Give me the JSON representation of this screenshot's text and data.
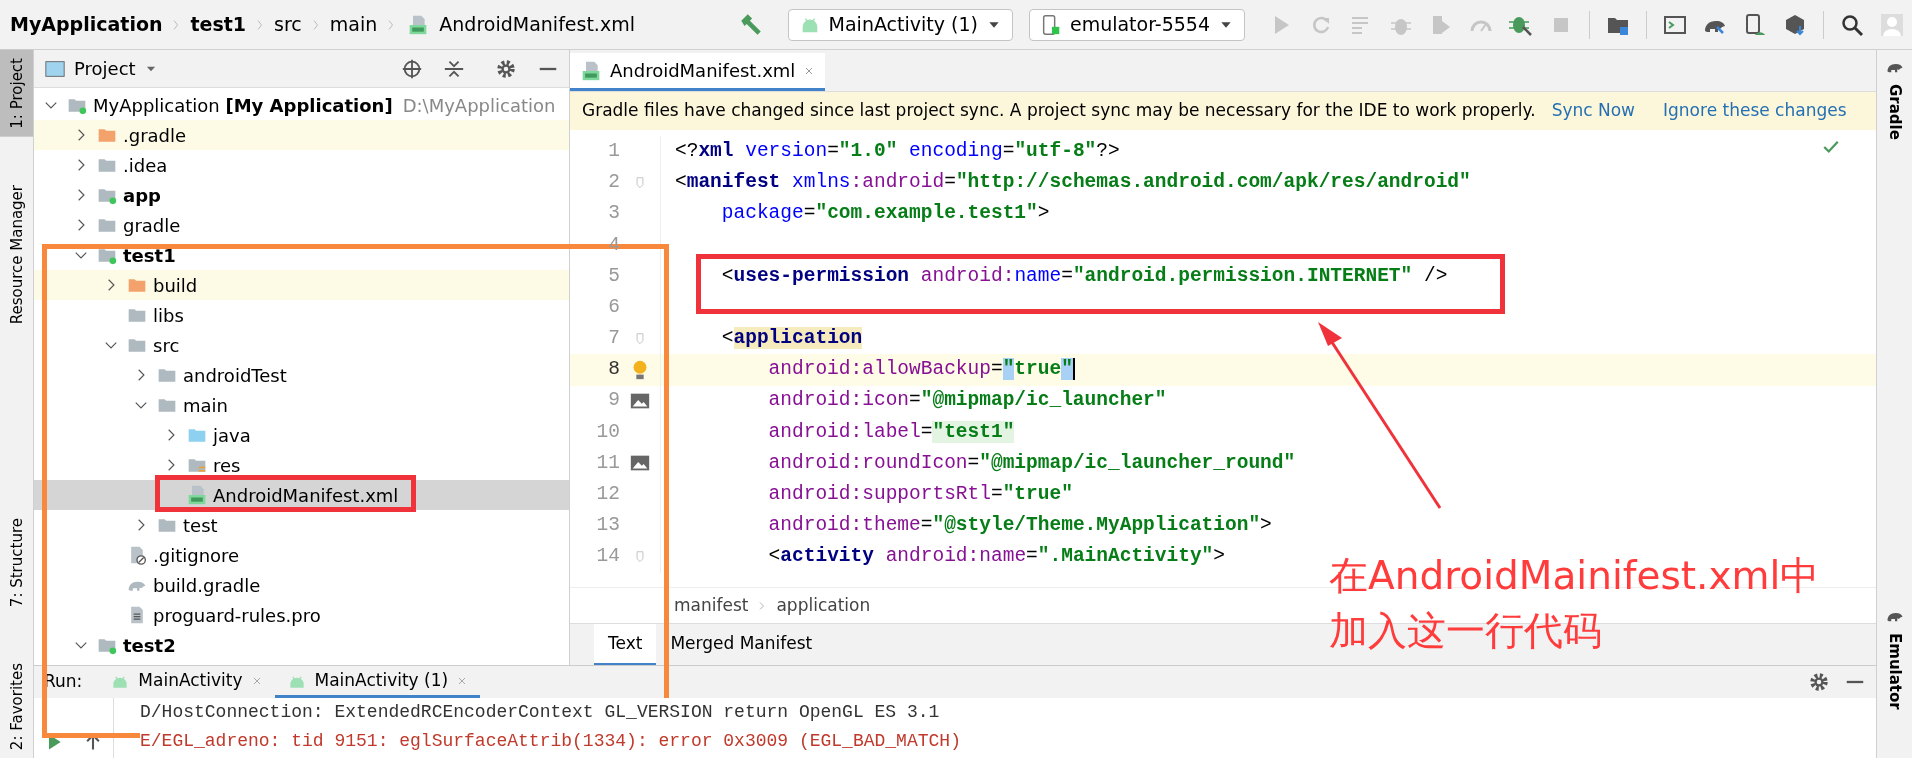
{
  "breadcrumb": [
    {
      "label": "MyApplication",
      "bold": true,
      "kind": "text"
    },
    {
      "label": "test1",
      "bold": true,
      "kind": "text"
    },
    {
      "label": "src",
      "bold": false,
      "kind": "text"
    },
    {
      "label": "main",
      "bold": false,
      "kind": "text"
    },
    {
      "label": "AndroidManifest.xml",
      "bold": false,
      "kind": "manifest"
    }
  ],
  "toolbar": {
    "run_config": "MainActivity (1)",
    "device": "emulator-5554"
  },
  "left_strip": [
    {
      "label": "1: Project",
      "selected": true
    },
    {
      "label": "Resource Manager",
      "selected": false
    },
    {
      "label": "7: Structure",
      "selected": false
    },
    {
      "label": "2: Favorites",
      "selected": false
    }
  ],
  "right_strip": [
    {
      "label": "Gradle"
    },
    {
      "label": "Emulator"
    }
  ],
  "project": {
    "title": "Project",
    "tree": [
      {
        "label": "MyApplication **[My Application]**",
        "path": "D:\\MyApplication",
        "kind": "module",
        "expanded": true,
        "selected": false,
        "children": [
          {
            "label": ".gradle",
            "kind": "excluded",
            "expanded": false,
            "selected": false,
            "highlighted": true
          },
          {
            "label": ".idea",
            "kind": "folder",
            "expanded": false,
            "selected": false
          },
          {
            "label": "**app**",
            "kind": "module",
            "expanded": false,
            "selected": false
          },
          {
            "label": "gradle",
            "kind": "folder",
            "expanded": false,
            "selected": false
          },
          {
            "label": "**test1**",
            "kind": "module",
            "expanded": true,
            "selected": false,
            "children": [
              {
                "label": "build",
                "kind": "excluded",
                "expanded": false,
                "selected": false,
                "highlighted": true
              },
              {
                "label": "libs",
                "kind": "folder",
                "selected": false
              },
              {
                "label": "src",
                "kind": "folder",
                "expanded": true,
                "selected": false,
                "children": [
                  {
                    "label": "androidTest",
                    "kind": "folder",
                    "expanded": false,
                    "selected": false
                  },
                  {
                    "label": "main",
                    "kind": "folder",
                    "expanded": true,
                    "selected": false,
                    "children": [
                      {
                        "label": "java",
                        "kind": "source",
                        "expanded": false,
                        "selected": false
                      },
                      {
                        "label": "res",
                        "kind": "res",
                        "expanded": false,
                        "selected": false
                      },
                      {
                        "label": "AndroidManifest.xml",
                        "kind": "manifest",
                        "selected": true
                      }
                    ]
                  },
                  {
                    "label": "test",
                    "kind": "folder",
                    "expanded": false,
                    "selected": false
                  }
                ]
              },
              {
                "label": ".gitignore",
                "kind": "ignore",
                "selected": false
              },
              {
                "label": "build.gradle",
                "kind": "gradle",
                "selected": false
              },
              {
                "label": "proguard-rules.pro",
                "kind": "textfile",
                "selected": false
              }
            ]
          },
          {
            "label": "**test2**",
            "kind": "module",
            "expanded": true,
            "selected": false
          }
        ]
      }
    ]
  },
  "editor": {
    "tabs": [
      {
        "label": "AndroidManifest.xml",
        "selected": true
      }
    ],
    "banner": {
      "text": "Gradle files have changed since last project sync. A project sync may be necessary for the IDE to work properly.",
      "links": [
        "Sync Now",
        "Ignore these changes"
      ]
    },
    "lines": [
      {
        "number": "1",
        "current": false,
        "tokens": [
          {
            "kind": "p",
            "text": "<?"
          },
          {
            "kind": "tag",
            "text": "xml"
          },
          {
            "kind": "attr",
            "text": " version"
          },
          {
            "kind": "p",
            "text": "="
          },
          {
            "kind": "str",
            "text": "\"1.0\""
          },
          {
            "kind": "attr",
            "text": " encoding"
          },
          {
            "kind": "p",
            "text": "="
          },
          {
            "kind": "str",
            "text": "\"utf-8\""
          },
          {
            "kind": "p",
            "text": "?>"
          }
        ]
      },
      {
        "number": "2",
        "current": false,
        "kind": "fold",
        "tokens": [
          {
            "kind": "p",
            "text": "<"
          },
          {
            "kind": "tag",
            "text": "manifest"
          },
          {
            "kind": "attr",
            "text": " xmlns"
          },
          {
            "kind": "ns",
            "text": ":android"
          },
          {
            "kind": "p",
            "text": "="
          },
          {
            "kind": "str",
            "text": "\"http://schemas.android.com/apk/res/android\""
          }
        ]
      },
      {
        "number": "3",
        "current": false,
        "tokens": [
          {
            "kind": "attr",
            "text": "    package"
          },
          {
            "kind": "p",
            "text": "="
          },
          {
            "kind": "str",
            "text": "\"com.example.test1\""
          },
          {
            "kind": "p",
            "text": ">"
          }
        ]
      },
      {
        "number": "4",
        "current": false
      },
      {
        "number": "5",
        "current": false,
        "tokens": [
          {
            "kind": "p",
            "text": "    <"
          },
          {
            "kind": "tag",
            "text": "uses-permission"
          },
          {
            "kind": "ns",
            "text": " android:"
          },
          {
            "kind": "attr",
            "text": "name"
          },
          {
            "kind": "p",
            "text": "="
          },
          {
            "kind": "str",
            "text": "\"android.permission.INTERNET\""
          },
          {
            "kind": "p",
            "text": " />"
          }
        ]
      },
      {
        "number": "6",
        "current": false
      },
      {
        "number": "7",
        "current": false,
        "kind": "fold",
        "tokens": [
          {
            "kind": "p",
            "text": "    <"
          },
          {
            "kind": "tag_hl",
            "text": "application"
          }
        ]
      },
      {
        "number": "8",
        "current": true,
        "kind": "bulb",
        "tokens": [
          {
            "kind": "ns",
            "text": "        android:allowBackup"
          },
          {
            "kind": "p",
            "text": "="
          },
          {
            "kind": "str_hl",
            "text": "\""
          },
          {
            "kind": "str",
            "text": "true"
          },
          {
            "kind": "str_hl",
            "text": "\""
          }
        ]
      },
      {
        "number": "9",
        "current": false,
        "kind": "image",
        "tokens": [
          {
            "kind": "ns",
            "text": "        android:icon"
          },
          {
            "kind": "p",
            "text": "="
          },
          {
            "kind": "str",
            "text": "\"@mipmap/ic_launcher\""
          }
        ]
      },
      {
        "number": "10",
        "current": false,
        "tokens": [
          {
            "kind": "ns",
            "text": "        android:label"
          },
          {
            "kind": "p",
            "text": "="
          },
          {
            "kind": "str_fold",
            "text": "\"test1\""
          }
        ]
      },
      {
        "number": "11",
        "current": false,
        "kind": "image",
        "tokens": [
          {
            "kind": "ns",
            "text": "        android:roundIcon"
          },
          {
            "kind": "p",
            "text": "="
          },
          {
            "kind": "str",
            "text": "\"@mipmap/ic_launcher_round\""
          }
        ]
      },
      {
        "number": "12",
        "current": false,
        "tokens": [
          {
            "kind": "ns",
            "text": "        android:supportsRtl"
          },
          {
            "kind": "p",
            "text": "="
          },
          {
            "kind": "str",
            "text": "\"true\""
          }
        ]
      },
      {
        "number": "13",
        "current": false,
        "tokens": [
          {
            "kind": "ns",
            "text": "        android:theme"
          },
          {
            "kind": "p",
            "text": "="
          },
          {
            "kind": "str",
            "text": "\"@style/Theme.MyApplication\""
          },
          {
            "kind": "p",
            "text": ">"
          }
        ]
      },
      {
        "number": "14",
        "current": false,
        "kind": "fold",
        "tokens": [
          {
            "kind": "p",
            "text": "        <"
          },
          {
            "kind": "tag",
            "text": "activity"
          },
          {
            "kind": "ns",
            "text": " android:name"
          },
          {
            "kind": "p",
            "text": "="
          },
          {
            "kind": "str",
            "text": "\".MainActivity\""
          },
          {
            "kind": "p",
            "text": ">"
          }
        ]
      }
    ],
    "path": [
      "manifest",
      "application"
    ],
    "bottom_tabs": [
      {
        "label": "Text",
        "selected": true
      },
      {
        "label": "Merged Manifest",
        "selected": false
      }
    ]
  },
  "run": {
    "label": "Run:",
    "tabs": [
      {
        "label": "MainActivity",
        "selected": false
      },
      {
        "label": "MainActivity (1)",
        "selected": true
      }
    ],
    "console": [
      {
        "text": "D/HostConnection: ExtendedRCEncoderContext GL_VERSION return OpenGL ES 3.1",
        "kind": "debug"
      },
      {
        "text": "E/EGL_adreno: tid 9151: eglSurfaceAttrib(1334): error 0x3009 (EGL_BAD_MATCH)",
        "kind": "error"
      }
    ]
  },
  "annotation": {
    "callout_lines": [
      "在AndroidMainifest.xml中",
      "加入这一行代码"
    ]
  }
}
